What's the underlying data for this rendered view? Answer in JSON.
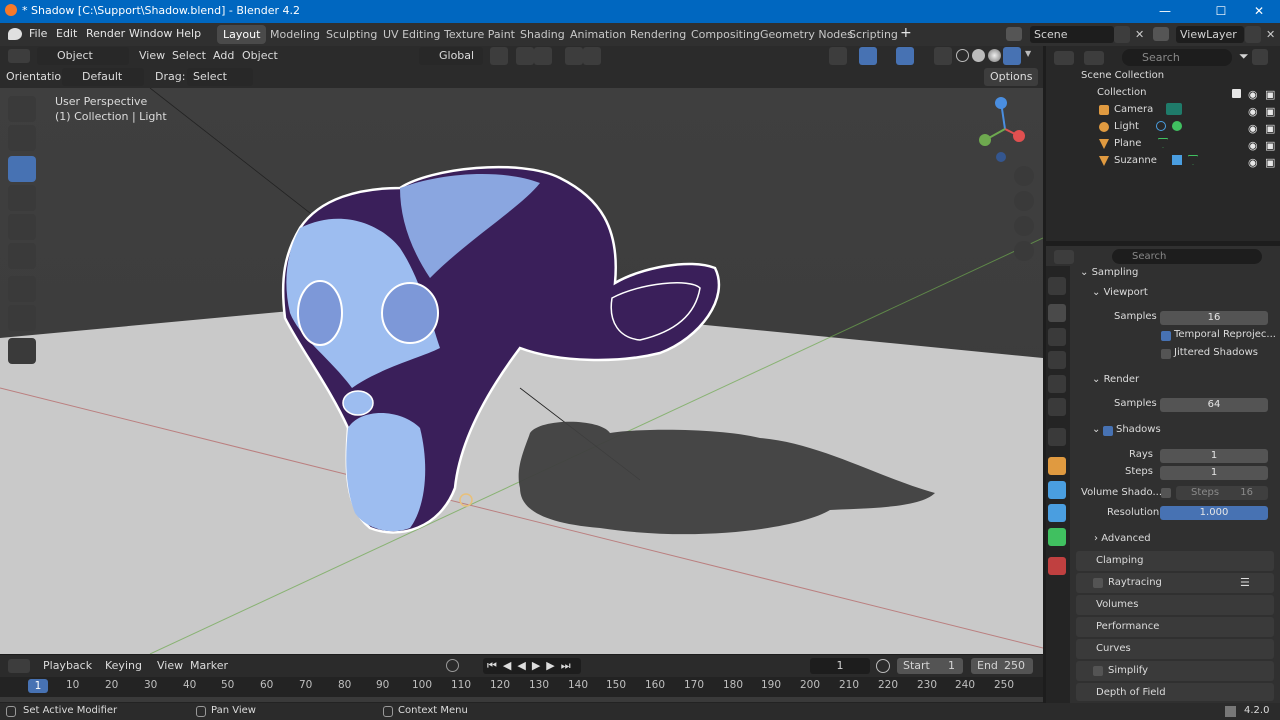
{
  "window": {
    "title": "* Shadow [C:\\Support\\Shadow.blend] - Blender 4.2"
  },
  "menu": [
    "File",
    "Edit",
    "Render",
    "Window",
    "Help"
  ],
  "workspaces": [
    "Layout",
    "Modeling",
    "Sculpting",
    "UV Editing",
    "Texture Paint",
    "Shading",
    "Animation",
    "Rendering",
    "Compositing",
    "Geometry Nodes",
    "Scripting"
  ],
  "scene": {
    "scene_name": "Scene",
    "view_layer": "ViewLayer"
  },
  "viewport_header": {
    "mode": "Object Mode",
    "menus": [
      "View",
      "Select",
      "Add",
      "Object"
    ],
    "orientation_value": "Global",
    "orientation_label": "Orientation:",
    "orientation_default": "Default",
    "drag_label": "Drag:",
    "drag_value": "Select Box",
    "options": "Options"
  },
  "viewport": {
    "view_name": "User Perspective",
    "collection_info": "(1) Collection | Light"
  },
  "outliner": {
    "search_placeholder": "Search",
    "root": "Scene Collection",
    "collection": "Collection",
    "items": [
      "Camera",
      "Light",
      "Plane",
      "Suzanne"
    ]
  },
  "properties": {
    "search_placeholder": "Search",
    "sampling": "Sampling",
    "viewport": "Viewport",
    "samples_label": "Samples",
    "viewport_samples": "16",
    "temporal": "Temporal Reprojec...",
    "jittered": "Jittered Shadows",
    "render": "Render",
    "render_samples": "64",
    "shadows": "Shadows",
    "rays_label": "Rays",
    "rays": "1",
    "steps_label": "Steps",
    "steps": "1",
    "volume_shadows": "Volume Shado...",
    "volume_steps": "Steps",
    "volume_steps_value": "16",
    "resolution_label": "Resolution",
    "resolution": "1.000",
    "advanced": "Advanced",
    "panels": [
      "Clamping",
      "Raytracing",
      "Volumes",
      "Performance",
      "Curves",
      "Simplify",
      "Depth of Field"
    ]
  },
  "timeline": {
    "menus": [
      "Playback",
      "Keying",
      "View",
      "Marker"
    ],
    "current_frame": "1",
    "start_label": "Start",
    "start": "1",
    "end_label": "End",
    "end": "250",
    "ticks": [
      "10",
      "20",
      "30",
      "40",
      "50",
      "60",
      "70",
      "80",
      "90",
      "100",
      "110",
      "120",
      "130",
      "140",
      "150",
      "160",
      "170",
      "180",
      "190",
      "200",
      "210",
      "220",
      "230",
      "240",
      "250"
    ],
    "playhead": "1"
  },
  "status": {
    "left": "Set Active Modifier",
    "middle": "Pan View",
    "right": "Context Menu",
    "version": "4.2.0"
  }
}
